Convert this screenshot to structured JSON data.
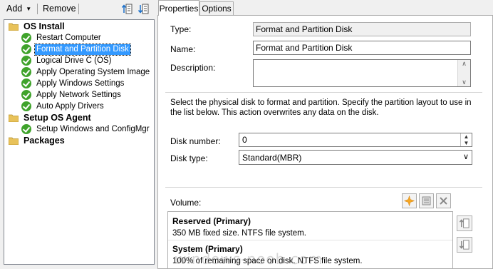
{
  "toolbar": {
    "add_label": "Add",
    "remove_label": "Remove"
  },
  "tree": {
    "groups": [
      {
        "label": "OS Install",
        "items": [
          "Restart Computer",
          "Format and Partition Disk",
          "Logical Drive C (OS)",
          "Apply Operating System Image",
          "Apply Windows Settings",
          "Apply Network Settings",
          "Auto Apply Drivers"
        ]
      },
      {
        "label": "Setup OS Agent",
        "items": [
          "Setup Windows and ConfigMgr"
        ]
      },
      {
        "label": "Packages",
        "items": []
      }
    ],
    "selected": "Format and Partition Disk"
  },
  "tabs": {
    "properties": "Properties",
    "options": "Options"
  },
  "form": {
    "type_label": "Type:",
    "type_value": "Format and Partition Disk",
    "name_label": "Name:",
    "name_value": "Format and Partition Disk",
    "description_label": "Description:",
    "description_value": "",
    "instructions": "Select the physical disk to format and partition. Specify the partition layout to use in the list below. This action overwrites any data on the disk.",
    "disk_number_label": "Disk number:",
    "disk_number_value": "0",
    "disk_type_label": "Disk type:",
    "disk_type_value": "Standard(MBR)",
    "volume_label": "Volume:"
  },
  "volumes": [
    {
      "title": "Reserved (Primary)",
      "desc": "350 MB fixed size. NTFS file system."
    },
    {
      "title": "System (Primary)",
      "desc": "100% of remaining space on disk. NTFS file system."
    }
  ],
  "watermark": "windows-noob.com",
  "colors": {
    "selection": "#3399ff",
    "check_green": "#3fa32b",
    "folder_yellow": "#e8c25a",
    "star_orange": "#f5a623"
  }
}
